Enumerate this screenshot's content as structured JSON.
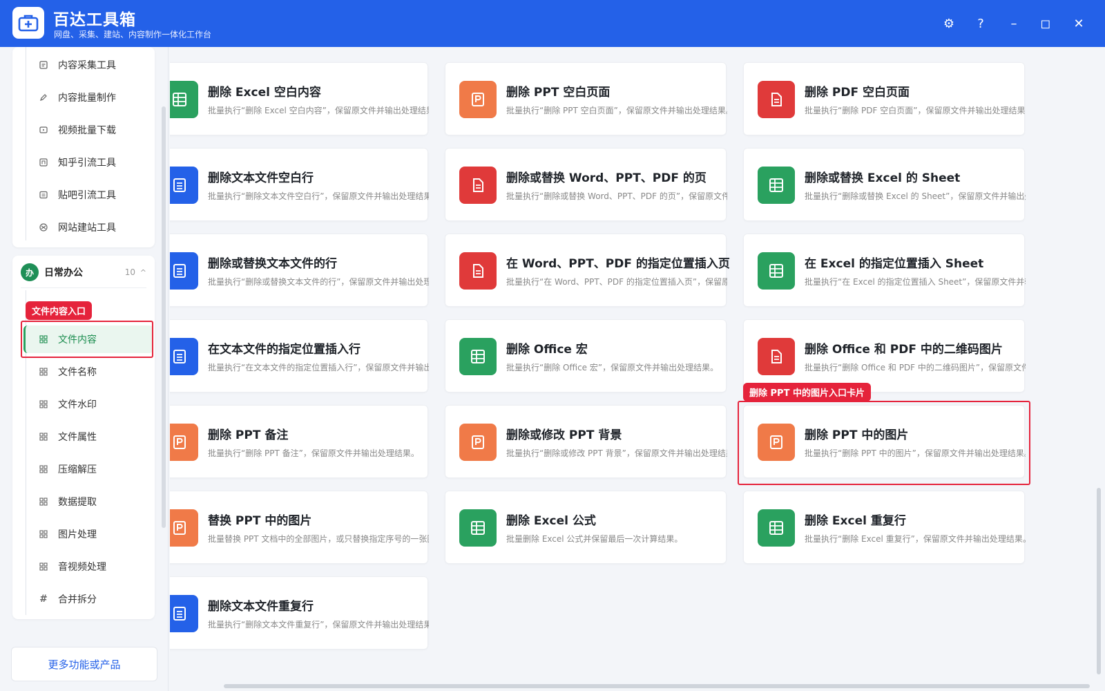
{
  "header": {
    "title": "百达工具箱",
    "subtitle": "网盘、采集、建站、内容制作一体化工作台",
    "controls": {
      "settings": "⚙",
      "help": "?",
      "minimize": "–",
      "maximize": "◻",
      "close": "✕"
    }
  },
  "sidebar": {
    "top_items": [
      {
        "label": "内容采集工具",
        "icon": "document-icon"
      },
      {
        "label": "内容批量制作",
        "icon": "pen-icon"
      },
      {
        "label": "视频批量下载",
        "icon": "video-icon"
      },
      {
        "label": "知乎引流工具",
        "icon": "zhihu-icon"
      },
      {
        "label": "贴吧引流工具",
        "icon": "tieba-icon"
      },
      {
        "label": "网站建站工具",
        "icon": "website-icon"
      }
    ],
    "group": {
      "badge": "办",
      "title": "日常办公",
      "count": "10",
      "caret": "^"
    },
    "group_items": [
      {
        "label": "文件内容",
        "icon": "grid-icon"
      },
      {
        "label": "文件名称",
        "icon": "grid-icon"
      },
      {
        "label": "文件水印",
        "icon": "grid-icon"
      },
      {
        "label": "文件属性",
        "icon": "grid-icon"
      },
      {
        "label": "压缩解压",
        "icon": "grid-icon"
      },
      {
        "label": "数据提取",
        "icon": "grid-icon"
      },
      {
        "label": "图片处理",
        "icon": "grid-icon"
      },
      {
        "label": "音视频处理",
        "icon": "grid-icon"
      },
      {
        "label": "合并拆分",
        "icon": "hash-icon"
      }
    ],
    "more_label": "更多功能或产品"
  },
  "annotations": {
    "sidebar_tag": "文件内容入口",
    "card_tag": "删除 PPT 中的图片入口卡片"
  },
  "cards": [
    {
      "title": "删除 Excel 空白内容",
      "desc": "批量执行“删除 Excel 空白内容”，保留原文件并输出处理结果。",
      "type": "excel",
      "color": "#2aa15f"
    },
    {
      "title": "删除 PPT 空白页面",
      "desc": "批量执行“删除 PPT 空白页面”，保留原文件并输出处理结果。",
      "type": "ppt",
      "color": "#f07a48"
    },
    {
      "title": "删除 PDF 空白页面",
      "desc": "批量执行“删除 PDF 空白页面”，保留原文件并输出处理结果。",
      "type": "pdf",
      "color": "#e03a3a"
    },
    {
      "title": "删除文本文件空白行",
      "desc": "批量执行“删除文本文件空白行”，保留原文件并输出处理结果。",
      "type": "text",
      "color": "#2461e8"
    },
    {
      "title": "删除或替换 Word、PPT、PDF 的页",
      "desc": "批量执行“删除或替换 Word、PPT、PDF 的页”，保留原文件并输出处理结果。",
      "type": "pdf",
      "color": "#e03a3a"
    },
    {
      "title": "删除或替换 Excel 的 Sheet",
      "desc": "批量执行“删除或替换 Excel 的 Sheet”，保留原文件并输出处理结果。",
      "type": "excel",
      "color": "#2aa15f"
    },
    {
      "title": "删除或替换文本文件的行",
      "desc": "批量执行“删除或替换文本文件的行”，保留原文件并输出处理结果。",
      "type": "text",
      "color": "#2461e8"
    },
    {
      "title": "在 Word、PPT、PDF 的指定位置插入页",
      "desc": "批量执行“在 Word、PPT、PDF 的指定位置插入页”，保留原文件并输出处理结果。",
      "type": "pdf",
      "color": "#e03a3a"
    },
    {
      "title": "在 Excel 的指定位置插入 Sheet",
      "desc": "批量执行“在 Excel 的指定位置插入 Sheet”，保留原文件并输出处理结果。",
      "type": "excel",
      "color": "#2aa15f"
    },
    {
      "title": "在文本文件的指定位置插入行",
      "desc": "批量执行“在文本文件的指定位置插入行”，保留原文件并输出处理结果。",
      "type": "text",
      "color": "#2461e8"
    },
    {
      "title": "删除 Office 宏",
      "desc": "批量执行“删除 Office 宏”，保留原文件并输出处理结果。",
      "type": "excel",
      "color": "#2aa15f"
    },
    {
      "title": "删除 Office 和 PDF 中的二维码图片",
      "desc": "批量执行“删除 Office 和 PDF 中的二维码图片”，保留原文件并输出处理结果。",
      "type": "pdf",
      "color": "#e03a3a"
    },
    {
      "title": "删除 PPT 备注",
      "desc": "批量执行“删除 PPT 备注”，保留原文件并输出处理结果。",
      "type": "ppt",
      "color": "#f07a48"
    },
    {
      "title": "删除或修改 PPT 背景",
      "desc": "批量执行“删除或修改 PPT 背景”，保留原文件并输出处理结果。",
      "type": "ppt",
      "color": "#f07a48"
    },
    {
      "title": "删除 PPT 中的图片",
      "desc": "批量执行“删除 PPT 中的图片”，保留原文件并输出处理结果。",
      "type": "ppt",
      "color": "#f07a48"
    },
    {
      "title": "替换 PPT 中的图片",
      "desc": "批量替换 PPT 文档中的全部图片，或只替换指定序号的一张图片。",
      "type": "ppt",
      "color": "#f07a48"
    },
    {
      "title": "删除 Excel 公式",
      "desc": "批量删除 Excel 公式并保留最后一次计算结果。",
      "type": "excel",
      "color": "#2aa15f"
    },
    {
      "title": "删除 Excel 重复行",
      "desc": "批量执行“删除 Excel 重复行”，保留原文件并输出处理结果。",
      "type": "excel",
      "color": "#2aa15f"
    },
    {
      "title": "删除文本文件重复行",
      "desc": "批量执行“删除文本文件重复行”，保留原文件并输出处理结果。",
      "type": "text",
      "color": "#2461e8"
    }
  ]
}
